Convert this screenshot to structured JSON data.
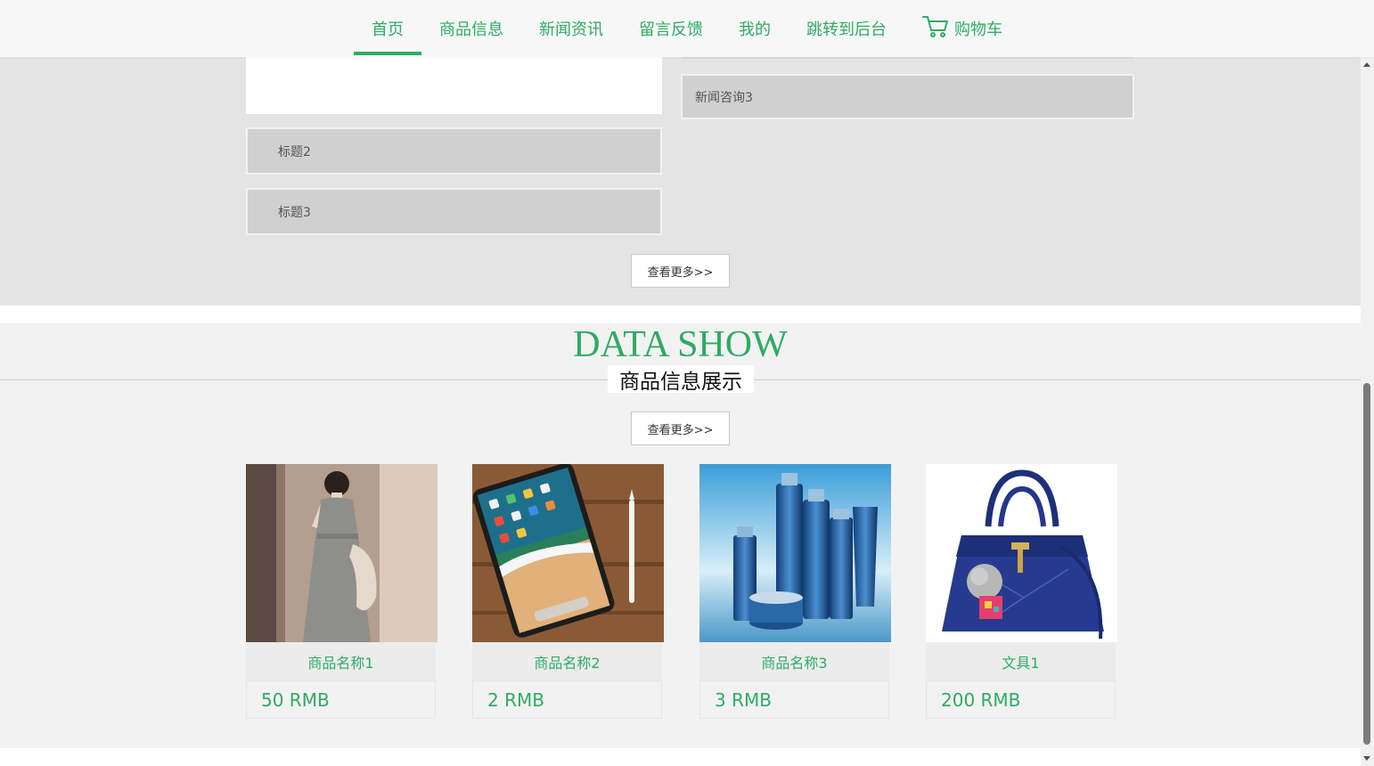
{
  "nav": {
    "items": [
      {
        "label": "首页",
        "active": true
      },
      {
        "label": "商品信息"
      },
      {
        "label": "新闻资讯"
      },
      {
        "label": "留言反馈"
      },
      {
        "label": "我的"
      },
      {
        "label": "跳转到后台"
      },
      {
        "label": "购物车",
        "icon": "cart-icon"
      }
    ]
  },
  "news": {
    "left_items": [
      "标题2",
      "标题3"
    ],
    "right_items": [
      "新闻咨询3"
    ],
    "more_label": "查看更多>>"
  },
  "data_show": {
    "title": "DATA SHOW",
    "subtitle": "商品信息展示",
    "more_label": "查看更多>>",
    "products": [
      {
        "name": "商品名称1",
        "price": "50 RMB",
        "image": "dress-photo"
      },
      {
        "name": "商品名称2",
        "price": "2 RMB",
        "image": "tablet-photo"
      },
      {
        "name": "商品名称3",
        "price": "3 RMB",
        "image": "cosmetics-photo"
      },
      {
        "name": "文具1",
        "price": "200 RMB",
        "image": "handbag-photo"
      }
    ]
  },
  "colors": {
    "accent": "#2eab64",
    "news_bg": "#e4e4e4",
    "section_bg": "#f2f2f2"
  }
}
